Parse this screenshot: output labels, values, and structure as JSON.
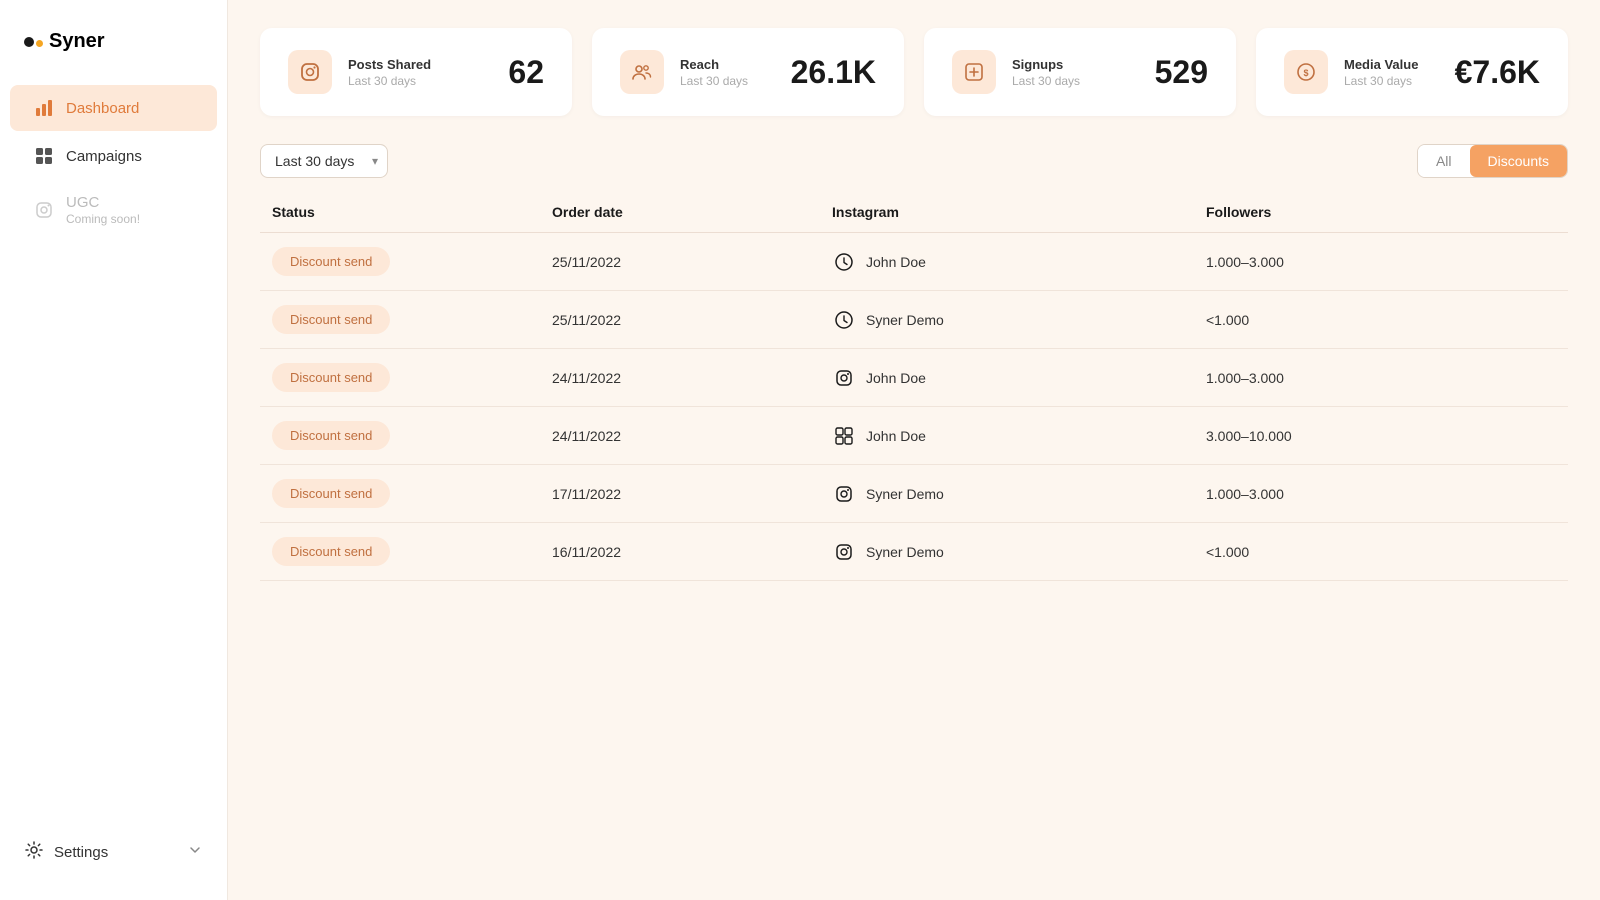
{
  "brand": {
    "name": "Syner"
  },
  "sidebar": {
    "items": [
      {
        "id": "dashboard",
        "label": "Dashboard",
        "icon": "bar-chart-icon",
        "active": true,
        "disabled": false,
        "sub": null
      },
      {
        "id": "campaigns",
        "label": "Campaigns",
        "icon": "grid-icon",
        "active": false,
        "disabled": false,
        "sub": null
      },
      {
        "id": "ugc",
        "label": "UGC",
        "icon": "instagram-icon",
        "active": false,
        "disabled": true,
        "sub": "Coming soon!"
      }
    ],
    "footer": {
      "label": "Settings",
      "icon": "settings-icon"
    }
  },
  "stats": [
    {
      "id": "posts-shared",
      "label": "Posts Shared",
      "sublabel": "Last 30 days",
      "value": "62",
      "icon": "instagram-icon"
    },
    {
      "id": "reach",
      "label": "Reach",
      "sublabel": "Last 30 days",
      "value": "26.1K",
      "icon": "users-icon"
    },
    {
      "id": "signups",
      "label": "Signups",
      "sublabel": "Last 30 days",
      "value": "529",
      "icon": "signups-icon"
    },
    {
      "id": "media-value",
      "label": "Media Value",
      "sublabel": "Last 30 days",
      "value": "€7.6K",
      "icon": "currency-icon"
    }
  ],
  "filter": {
    "period_label": "Last 30 days",
    "tabs": [
      {
        "id": "all",
        "label": "All",
        "active": false
      },
      {
        "id": "discounts",
        "label": "Discounts",
        "active": true
      }
    ]
  },
  "table": {
    "columns": [
      "Status",
      "Order date",
      "Instagram",
      "Followers"
    ],
    "rows": [
      {
        "status": "Discount send",
        "order_date": "25/11/2022",
        "instagram": "John Doe",
        "ig_icon": "clock-icon",
        "followers": "1.000–3.000"
      },
      {
        "status": "Discount send",
        "order_date": "25/11/2022",
        "instagram": "Syner Demo",
        "ig_icon": "clock-icon",
        "followers": "<1.000"
      },
      {
        "status": "Discount send",
        "order_date": "24/11/2022",
        "instagram": "John Doe",
        "ig_icon": "instagram-circle-icon",
        "followers": "1.000–3.000"
      },
      {
        "status": "Discount send",
        "order_date": "24/11/2022",
        "instagram": "John Doe",
        "ig_icon": "grid-circle-icon",
        "followers": "3.000–10.000"
      },
      {
        "status": "Discount send",
        "order_date": "17/11/2022",
        "instagram": "Syner Demo",
        "ig_icon": "instagram-circle-icon",
        "followers": "1.000–3.000"
      },
      {
        "status": "Discount send",
        "order_date": "16/11/2022",
        "instagram": "Syner Demo",
        "ig_icon": "instagram-circle-icon",
        "followers": "<1.000"
      }
    ]
  }
}
